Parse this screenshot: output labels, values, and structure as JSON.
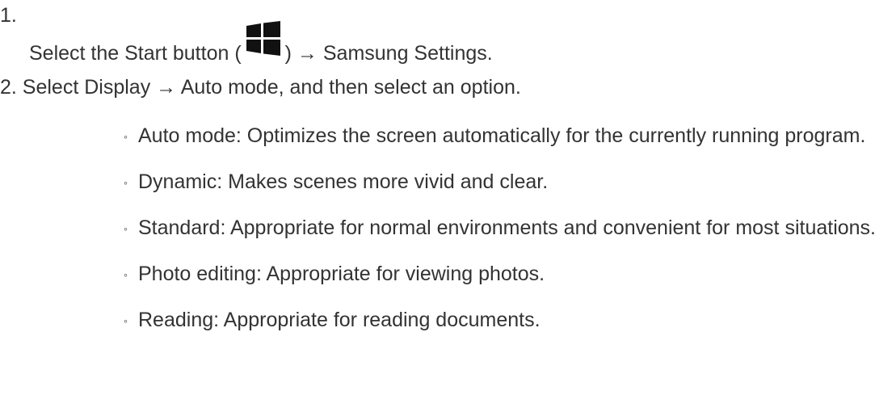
{
  "step1": {
    "number": "1.",
    "before_icon": "Select the Start button (",
    "icon": "windows-start-icon",
    "after_icon": ") → Samsung Settings."
  },
  "step2": {
    "text": "2. Select Display → Auto mode, and then select an option."
  },
  "options": [
    {
      "text": "Auto mode: Optimizes the screen automatically for the currently running program."
    },
    {
      "text": "Dynamic: Makes scenes more vivid and clear."
    },
    {
      "text": "Standard: Appropriate for normal environments and convenient for most situations."
    },
    {
      "text": "Photo editing: Appropriate for viewing photos."
    },
    {
      "text": "Reading: Appropriate for reading documents."
    }
  ],
  "bullet_glyph": "◦",
  "colors": {
    "text": "#333333",
    "icon": "#111111"
  }
}
